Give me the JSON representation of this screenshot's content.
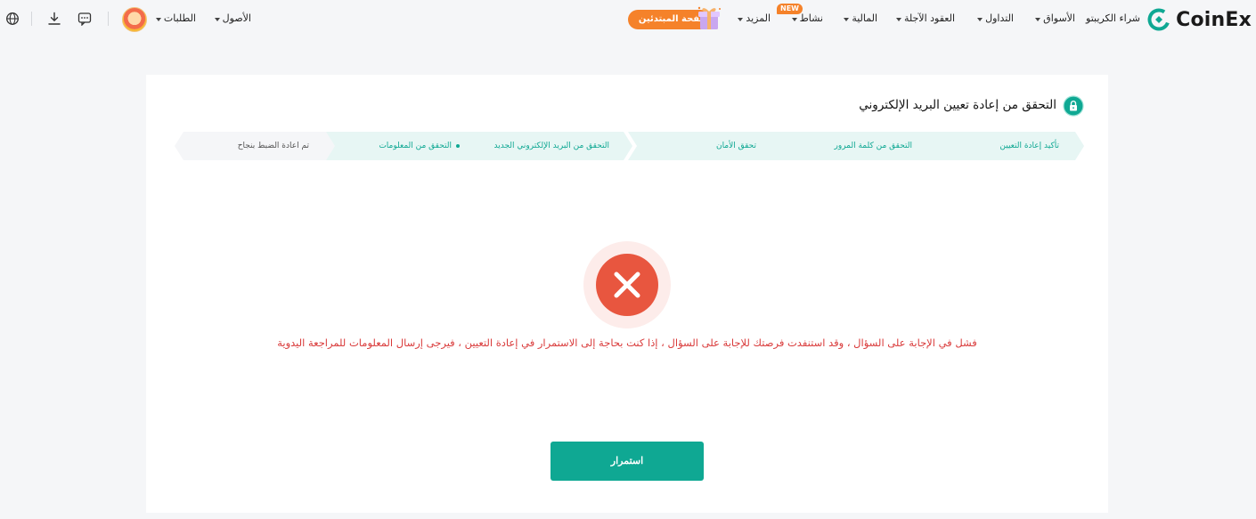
{
  "header": {
    "brand": "CoinEx",
    "nav": [
      {
        "label": "شراء الكريبتو",
        "dropdown": false
      },
      {
        "label": "الأسواق",
        "dropdown": true
      },
      {
        "label": "التداول",
        "dropdown": true
      },
      {
        "label": "العقود الآجلة",
        "dropdown": true
      },
      {
        "label": "المالية",
        "dropdown": true
      },
      {
        "label": "نشاط",
        "dropdown": true,
        "badge": "NEW"
      },
      {
        "label": "المزيد",
        "dropdown": true
      }
    ],
    "beginner_button": "صفحة المبتدئين",
    "right_nav": [
      {
        "label": "الأصول",
        "dropdown": true
      },
      {
        "label": "الطلبات",
        "dropdown": true
      }
    ],
    "icons": [
      "gift-icon",
      "avatar",
      "message-icon",
      "download-icon",
      "globe-icon"
    ]
  },
  "page": {
    "title": "التحقق من إعادة تعيين البريد الإلكتروني",
    "steps": [
      {
        "label": "تأكيد إعادة التعيين",
        "state": "done"
      },
      {
        "label": "التحقق من كلمة المرور",
        "state": "done"
      },
      {
        "label": "تحقق الأمان",
        "state": "done"
      },
      {
        "label": "التحقق من البريد الإلكتروني الجديد",
        "state": "done"
      },
      {
        "label": "التحقق من المعلومات",
        "state": "current"
      },
      {
        "label": "تم اعادة الضبط بنجاح",
        "state": "todo"
      }
    ],
    "error_message": "فشل في الإجابة على السؤال ، وقد استنفدت فرصتك للإجابة على السؤال ، إذا كنت بحاجة إلى الاستمرار في إعادة التعيين ، فيرجى إرسال المعلومات للمراجعة اليدوية",
    "continue_button": "استمرار"
  },
  "colors": {
    "brand": "#0fa893",
    "accent_orange": "#f5822a",
    "error": "#d93a3a",
    "step_done_bg": "#e7f6f4",
    "step_todo_bg": "#f5f6f8"
  }
}
